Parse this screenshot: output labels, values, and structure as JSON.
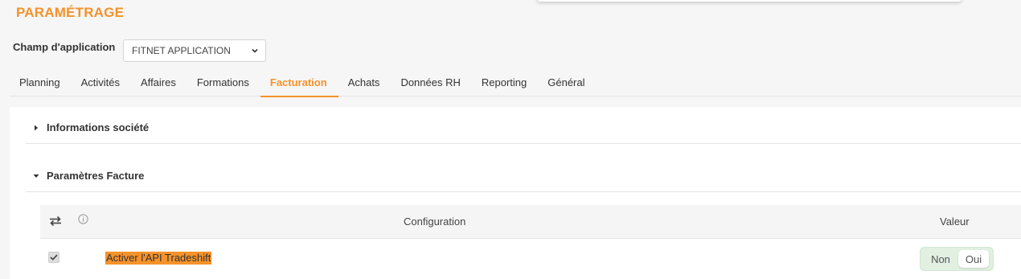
{
  "page": {
    "title": "PARAMÉTRAGE"
  },
  "scope": {
    "label": "Champ d'application",
    "selected": "FITNET APPLICATION"
  },
  "tabs": [
    {
      "label": "Planning"
    },
    {
      "label": "Activités"
    },
    {
      "label": "Affaires"
    },
    {
      "label": "Formations"
    },
    {
      "label": "Facturation",
      "active": true
    },
    {
      "label": "Achats"
    },
    {
      "label": "Données RH"
    },
    {
      "label": "Reporting"
    },
    {
      "label": "Général"
    }
  ],
  "sections": [
    {
      "title": "Informations société",
      "expanded": false
    },
    {
      "title": "Paramètres Facture",
      "expanded": true
    }
  ],
  "grid": {
    "columns": {
      "config": "Configuration",
      "value": "Valeur"
    },
    "rows": [
      {
        "label": "Activer l'API Tradeshift",
        "checked": true,
        "toggle": {
          "off": "Non",
          "on": "Oui",
          "value": "Oui"
        }
      }
    ]
  },
  "colors": {
    "accent": "#f5922a",
    "toggle_bg": "#e2f0e2"
  },
  "icons": {
    "swap": "swap-arrows-icon",
    "info": "info-icon",
    "caret_right": "caret-right-icon",
    "caret_down": "caret-down-icon",
    "chevron": "chevron-down-icon",
    "check": "check-icon"
  }
}
